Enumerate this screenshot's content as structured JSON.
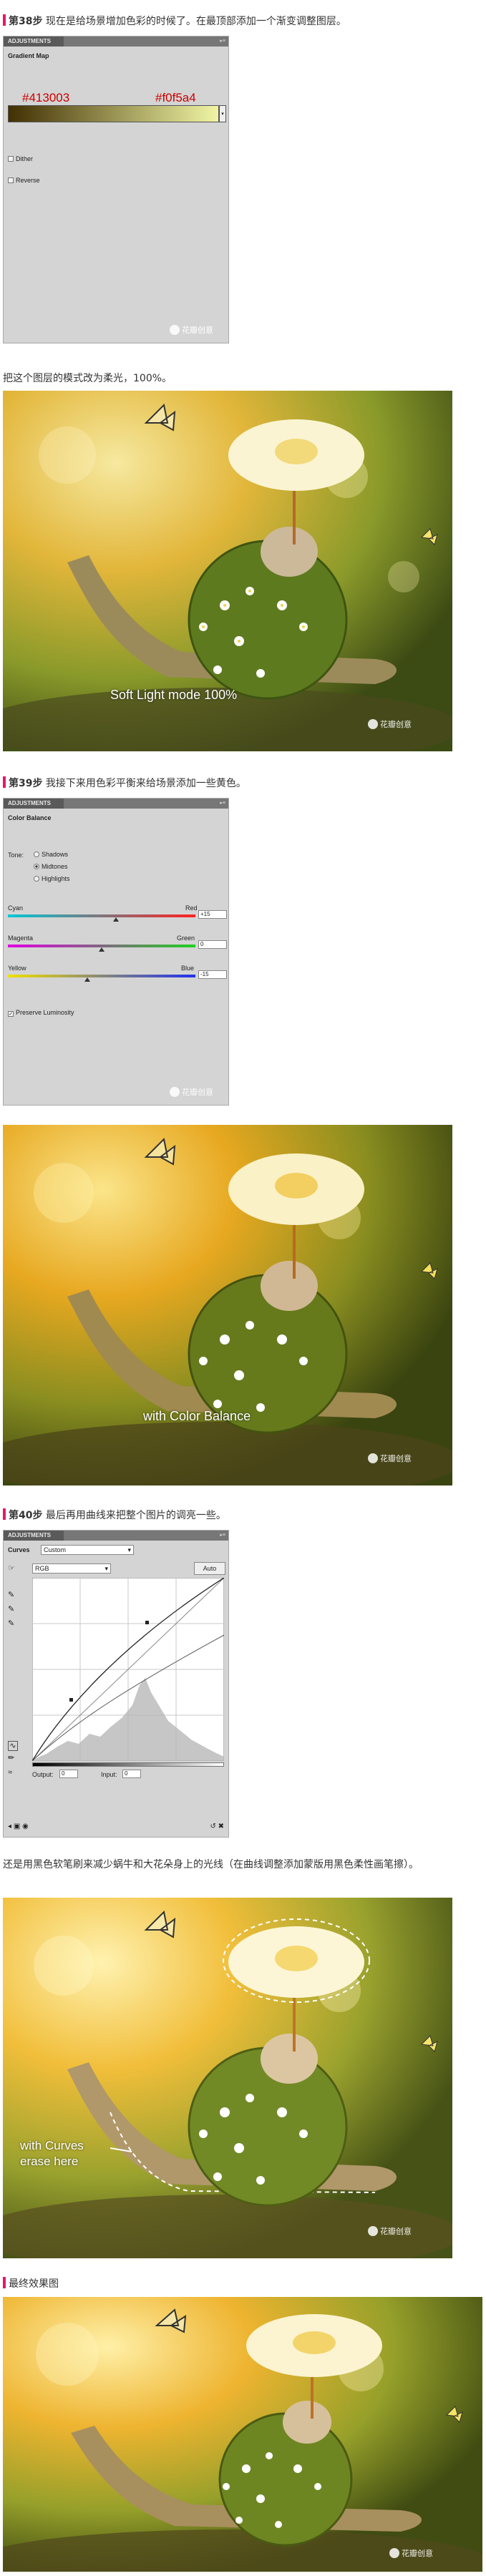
{
  "step38": {
    "number": "第38步",
    "text": " 现在是给场景增加色彩的时候了。在最顶部添加一个渐变调整图层。",
    "panel": {
      "tab": "ADJUSTMENTS",
      "title": "Gradient Map",
      "color_left": "#413003",
      "color_right": "#f0f5a4",
      "label_left": "#413003",
      "label_right": "#f0f5a4",
      "dither": "Dither",
      "reverse": "Reverse",
      "watermark": "花瓣创意"
    }
  },
  "soft_light": {
    "text": "把这个图层的模式改为柔光，100%。",
    "caption": "Soft Light mode 100%",
    "watermark": "花瓣创意"
  },
  "step39": {
    "number": "第39步",
    "text": " 我接下来用色彩平衡来给场景添加一些黄色。",
    "panel": {
      "tab": "ADJUSTMENTS",
      "title": "Color Balance",
      "tone_label": "Tone:",
      "tones": [
        "Shadows",
        "Midtones",
        "Highlights"
      ],
      "selected_tone": "Midtones",
      "sliders": [
        {
          "left": "Cyan",
          "right": "Red",
          "value": "+15",
          "amount": 15
        },
        {
          "left": "Magenta",
          "right": "Green",
          "value": "0",
          "amount": 0
        },
        {
          "left": "Yellow",
          "right": "Blue",
          "value": "-15",
          "amount": -15
        }
      ],
      "preserve": "Preserve Luminosity",
      "watermark": "花瓣创意"
    }
  },
  "color_balance_image": {
    "caption": "with Color Balance",
    "watermark": "花瓣创意"
  },
  "step40": {
    "number": "第40步",
    "text": " 最后再用曲线来把整个图片的调亮一些。",
    "panel": {
      "tab": "ADJUSTMENTS",
      "title": "Curves",
      "preset": "Custom",
      "channel": "RGB",
      "auto": "Auto",
      "output_label": "Output:",
      "output_value": "0",
      "input_label": "Input:",
      "input_value": "0"
    }
  },
  "curves_note": {
    "text": "还是用黑色软笔刷来减少蜗牛和大花朵身上的光线（在曲线调整添加蒙版用黑色柔性画笔擦）。",
    "caption_line1": "with Curves",
    "caption_line2": "erase here",
    "watermark": "花瓣创意"
  },
  "final": {
    "heading": "最终效果图",
    "watermark": "花瓣创意"
  },
  "colors": {
    "accent_bar": "#e5176e",
    "label_red": "#cc0000"
  }
}
